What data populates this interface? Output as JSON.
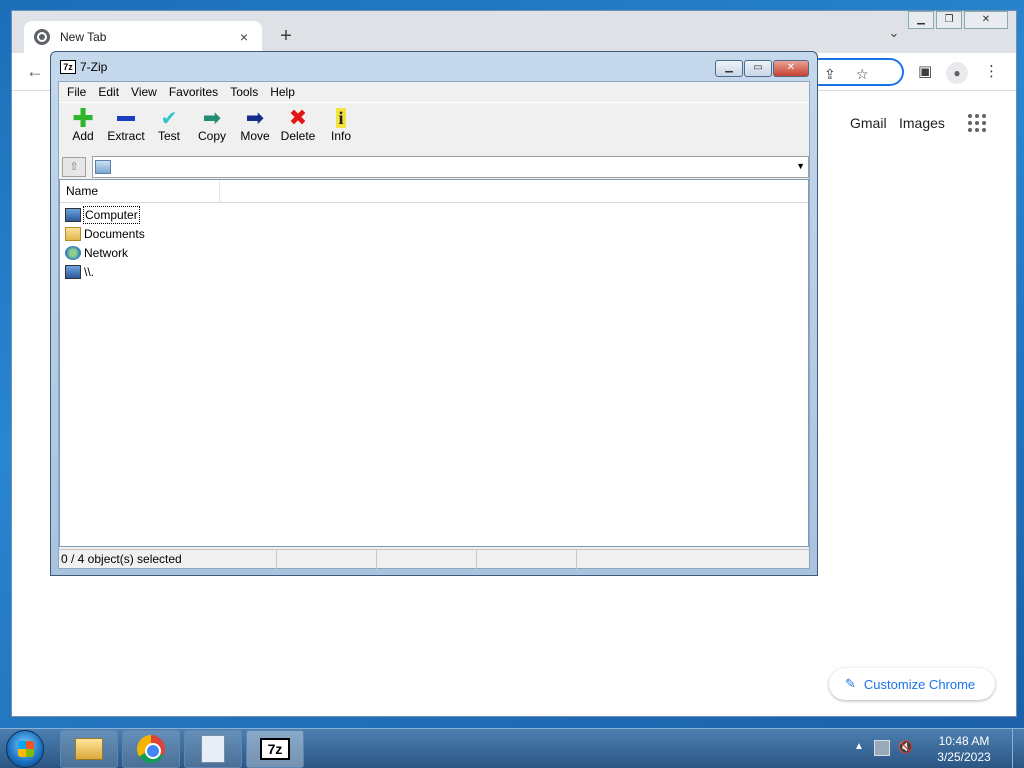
{
  "chrome": {
    "tab_title": "New Tab",
    "tab_close": "×",
    "new_tab": "+",
    "tab_search": "⌄",
    "gmail": "Gmail",
    "images": "Images",
    "customize": "Customize Chrome"
  },
  "zip": {
    "title": "7-Zip",
    "logo": "7z",
    "menu": [
      "File",
      "Edit",
      "View",
      "Favorites",
      "Tools",
      "Help"
    ],
    "toolbar": [
      {
        "label": "Add",
        "icon": "add-icon",
        "color": "#2db52d"
      },
      {
        "label": "Extract",
        "icon": "extract-icon",
        "color": "#1c3fc1"
      },
      {
        "label": "Test",
        "icon": "test-icon",
        "color": "#2ec7c9"
      },
      {
        "label": "Copy",
        "icon": "copy-icon",
        "color": "#1f8c73"
      },
      {
        "label": "Move",
        "icon": "move-icon",
        "color": "#132c8c"
      },
      {
        "label": "Delete",
        "icon": "delete-icon",
        "color": "#e21414"
      },
      {
        "label": "Info",
        "icon": "info-icon",
        "color": "#e7d21a"
      }
    ],
    "column_name": "Name",
    "items": [
      {
        "label": "Computer",
        "icon": "computer-icon"
      },
      {
        "label": "Documents",
        "icon": "folder-icon"
      },
      {
        "label": "Network",
        "icon": "network-icon"
      },
      {
        "label": "\\\\.",
        "icon": "computer-icon"
      }
    ],
    "status": "0 / 4 object(s) selected"
  },
  "taskbar": {
    "time": "10:48 AM",
    "date": "3/25/2023",
    "tb7z": "7z"
  }
}
